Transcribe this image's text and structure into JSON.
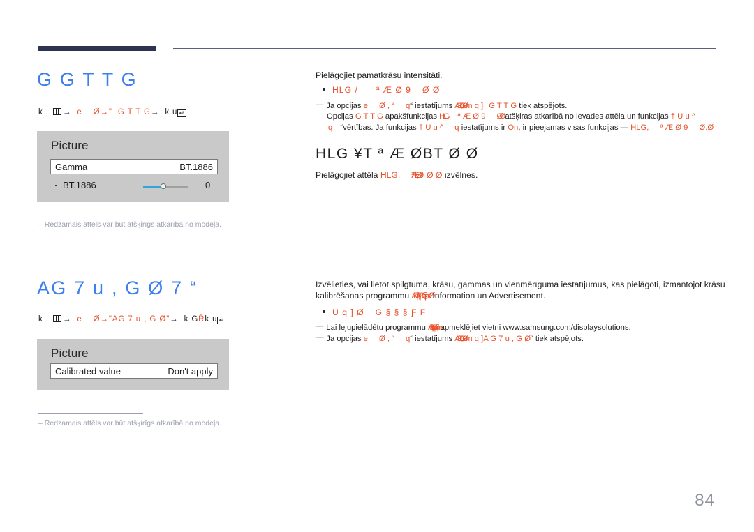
{
  "page": {
    "number": "84",
    "accent_color": "#e8502a",
    "heading_color": "#3d7fec",
    "rule_color": "#2e3352",
    "note_color": "#9aa0ae"
  },
  "sections": [
    {
      "heading": "G G T T G",
      "breadcrumb": {
        "prefix": "k ,",
        "icon": "menu-icon",
        "arrow1": "→",
        "step1": "e",
        "step2": "Ø",
        "arrow2": "→",
        "step3": "\"",
        "step4": "G T T G",
        "arrow3": "→",
        "step5": "k u",
        "enter_icon": "enter-key-icon"
      },
      "panel": {
        "title": "Picture",
        "row_label": "Gamma",
        "row_value": "BT.1886",
        "sub_label": "BT.1886",
        "sub_value": "0",
        "slider_percent": 43
      },
      "note": "Redzamais attēls var būt atšķirīgs atkarībā no modeļa."
    },
    {
      "heading": "AG 7  u , G Ø 7  “",
      "breadcrumb": {
        "prefix": "k ,",
        "icon": "menu-icon",
        "arrow1": "→",
        "step1": "e",
        "step2": "Ø",
        "arrow2": "→",
        "step3": "\"",
        "step4": "AG 7  u , G Ø",
        "step5": "\"",
        "arrow3": "→",
        "step6": "k G",
        "step7": "Ŕ",
        "step8": "k u",
        "enter_icon": "enter-key-icon"
      },
      "panel": {
        "title": "Picture",
        "row_label": "Calibrated value",
        "row_value": "Don't apply"
      },
      "note": "Redzamais attēls var būt atšķirīgs atkarībā no modeļa."
    }
  ],
  "right_column": {
    "gamma": {
      "intro": "Pielāgojiet pamatkrāsu intensitāti.",
      "bullet": {
        "part1": "HLG /",
        "part2": "ª Æ Ø 9",
        "part3": "Ø Ø"
      },
      "notes": [
        {
          "dash": "—",
          "seg": [
            {
              "t": "Ja opcijas ",
              "c": "black"
            },
            {
              "t": "e",
              "c": "accent"
            },
            {
              "t": "Ø , “",
              "c": "accent"
            },
            {
              "t": "q",
              "c": "accent"
            },
            {
              "t": "“ iestatījums ",
              "c": "black"
            },
            {
              "t": "A G 7  u , G Ø",
              "c": "accent"
            },
            {
              "t": "m q ]",
              "c": "accent"
            },
            {
              "t": "G T T G",
              "c": "accent"
            },
            {
              "t": " tiek atspējots.",
              "c": "black"
            }
          ]
        },
        {
          "dash": "",
          "seg": [
            {
              "t": "Opcijas ",
              "c": "black"
            },
            {
              "t": "G T T G",
              "c": "accent"
            },
            {
              "t": " apakšfunkcijas ",
              "c": "black"
            },
            {
              "t": "HLG,",
              "c": "accent"
            },
            {
              "t": "ª Æ Ø 9",
              "c": "accent"
            },
            {
              "t": "Ø Ø",
              "c": "accent"
            },
            {
              "t": " atšķiras atkarībā no ievades attēla un funkcijas ",
              "c": "black"
            },
            {
              "t": "† U u ^",
              "c": "accent"
            }
          ]
        },
        {
          "dash": "",
          "seg": [
            {
              "t": "q",
              "c": "accent"
            },
            {
              "t": " “vērtības. Ja funkcijas ",
              "c": "black"
            },
            {
              "t": "† U u ^",
              "c": "accent"
            },
            {
              "t": "q",
              "c": "accent"
            },
            {
              "t": " iestatījums ir ",
              "c": "black"
            },
            {
              "t": "On",
              "c": "accent"
            },
            {
              "t": ", ir pieejamas visas funkcijas — ",
              "c": "black"
            },
            {
              "t": "HLG,",
              "c": "accent"
            },
            {
              "t": "ª Æ Ø 9",
              "c": "accent"
            },
            {
              "t": "Ø.Ø",
              "c": "accent"
            }
          ]
        }
      ]
    },
    "hlg": {
      "heading": "HLG  ¥T  ª Æ ØBT   Ø Ø",
      "body_pre": "Pielāgojiet attēla ",
      "body_accent1": "HLG,",
      "body_accent2": "ª Æ , Ø 9",
      "body_accent3": "Ø Ø",
      "body_post": " izvēlnes."
    },
    "calibrated": {
      "intro_line1": "Izvēlieties, vai lietot spilgtuma, krāsu, gammas un vienmērīguma iestatījumus, kas pielāgoti, izmantojot krāsu",
      "intro_line2_pre": "kalibrēšanas programmu ",
      "intro_line2_accent": "A q 7 q ,  k Ø q § m Ø",
      "intro_line2_post": "Information un Advertisement.",
      "bullet": {
        "part1": "U q ]  Ø",
        "part2": "G § § § Ƒ F"
      },
      "notes": [
        {
          "dash": "—",
          "seg": [
            {
              "t": "Lai lejupielādētu programmu ",
              "c": "black"
            },
            {
              "t": "A q 7 q ,  k Ø q § m",
              "c": "accent"
            },
            {
              "t": "apmeklējiet vietni www.samsung.com/displaysolutions.",
              "c": "black"
            }
          ]
        },
        {
          "dash": "—",
          "seg": [
            {
              "t": "Ja opcijas ",
              "c": "black"
            },
            {
              "t": "e",
              "c": "accent"
            },
            {
              "t": "Ø , “",
              "c": "accent"
            },
            {
              "t": "q",
              "c": "accent"
            },
            {
              "t": "“ iestatījums ",
              "c": "black"
            },
            {
              "t": "A G 7  u , G Ø",
              "c": "accent"
            },
            {
              "t": "m q ]",
              "c": "accent"
            },
            {
              "t": "A G 7  u , G Ø",
              "c": "accent"
            },
            {
              "t": "“ tiek atspējots.",
              "c": "black"
            }
          ]
        }
      ]
    }
  }
}
